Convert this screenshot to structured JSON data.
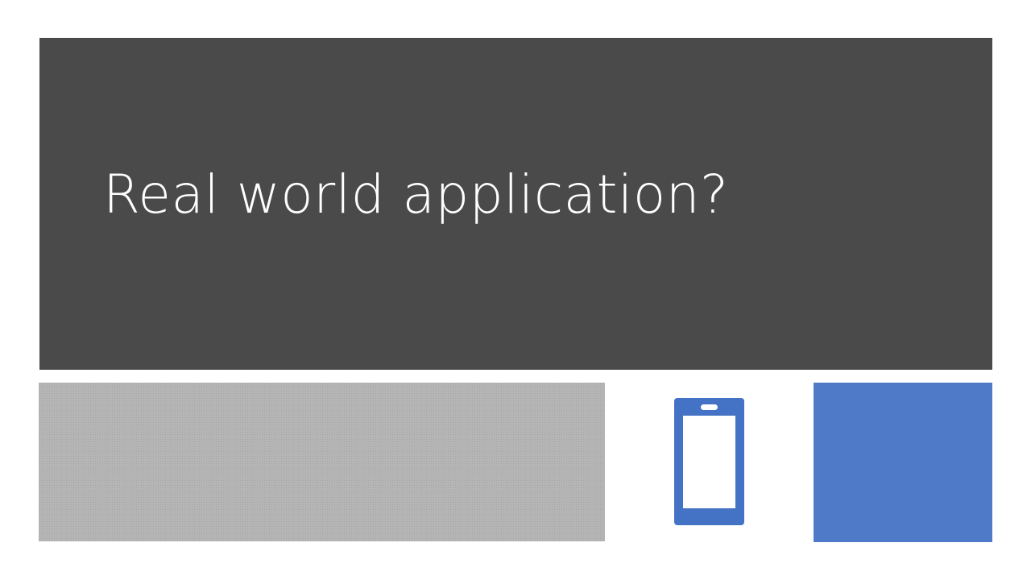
{
  "slide": {
    "title": "Real world application?"
  },
  "icons": {
    "phone": "mobile-phone-icon"
  },
  "colors": {
    "title_panel": "#4a4a4a",
    "title_text": "#ffffff",
    "gray_block": "#b5b5b5",
    "accent_blue": "#4f7ac7",
    "phone_icon": "#4472c4"
  }
}
